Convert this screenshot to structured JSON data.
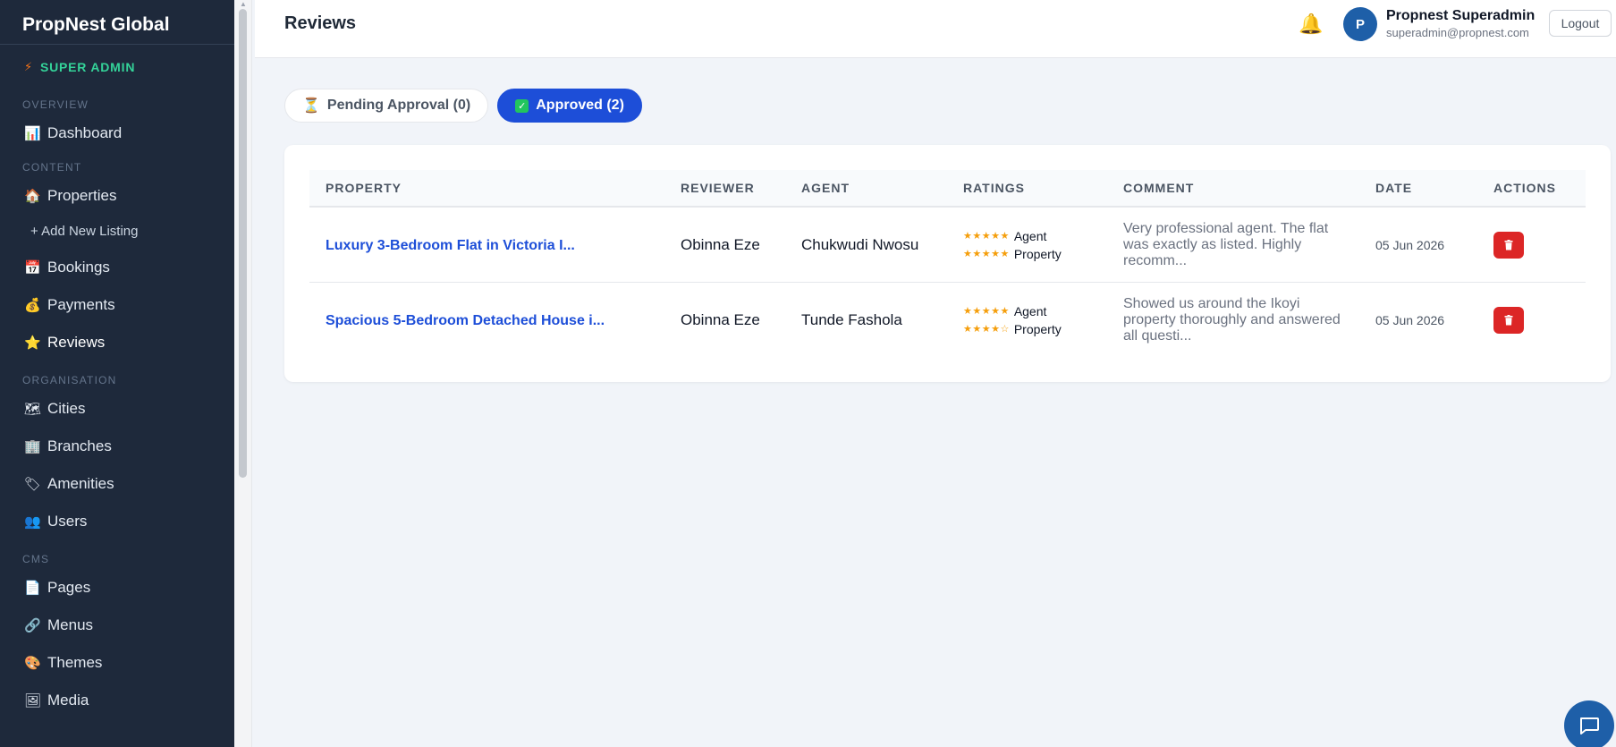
{
  "sidebar": {
    "brand": "PropNest Global",
    "role": "SUPER ADMIN",
    "sections": {
      "overview": "OVERVIEW",
      "content": "CONTENT",
      "organisation": "ORGANISATION",
      "cms": "CMS"
    },
    "items": {
      "dashboard": {
        "label": "Dashboard",
        "icon": "📊"
      },
      "properties": {
        "label": "Properties",
        "icon": "🏠"
      },
      "add_listing": {
        "label": "+ Add New Listing"
      },
      "bookings": {
        "label": "Bookings",
        "icon": "📅"
      },
      "payments": {
        "label": "Payments",
        "icon": "💰"
      },
      "reviews": {
        "label": "Reviews",
        "icon": "⭐"
      },
      "cities": {
        "label": "Cities",
        "icon": "🗺"
      },
      "branches": {
        "label": "Branches",
        "icon": "🏢"
      },
      "amenities": {
        "label": "Amenities",
        "icon": "🏷"
      },
      "users": {
        "label": "Users",
        "icon": "👥"
      },
      "pages": {
        "label": "Pages",
        "icon": "📄"
      },
      "menus": {
        "label": "Menus",
        "icon": "🔗"
      },
      "themes": {
        "label": "Themes",
        "icon": "🎨"
      },
      "media": {
        "label": "Media",
        "icon": "🖼"
      }
    }
  },
  "header": {
    "title": "Reviews",
    "user": {
      "initial": "P",
      "name": "Propnest Superadmin",
      "email": "superadmin@propnest.com"
    },
    "logout": "Logout"
  },
  "tabs": {
    "pending": {
      "icon": "⏳",
      "label": "Pending Approval (0)"
    },
    "approved": {
      "icon": "✓",
      "label": "Approved (2)"
    }
  },
  "table": {
    "columns": [
      "PROPERTY",
      "REVIEWER",
      "AGENT",
      "RATINGS",
      "COMMENT",
      "DATE",
      "ACTIONS"
    ],
    "rows": [
      {
        "property": "Luxury 3-Bedroom Flat in Victoria I...",
        "reviewer": "Obinna Eze",
        "agent": "Chukwudi Nwosu",
        "agent_stars": "★★★★★",
        "agent_label": "Agent",
        "property_stars": "★★★★★",
        "property_label": "Property",
        "comment": "Very professional agent. The flat was exactly as listed. Highly recomm...",
        "date": "05 Jun 2026"
      },
      {
        "property": "Spacious 5-Bedroom Detached House i...",
        "reviewer": "Obinna Eze",
        "agent": "Tunde Fashola",
        "agent_stars": "★★★★★",
        "agent_label": "Agent",
        "property_stars": "★★★★☆",
        "property_label": "Property",
        "comment": "Showed us around the Ikoyi property thoroughly and answered all questi...",
        "date": "05 Jun 2026"
      }
    ]
  },
  "colors": {
    "sidebar_bg": "#1e293b",
    "accent": "#1d4ed8",
    "role": "#34d399",
    "danger": "#dc2626",
    "star": "#f59e0b"
  }
}
